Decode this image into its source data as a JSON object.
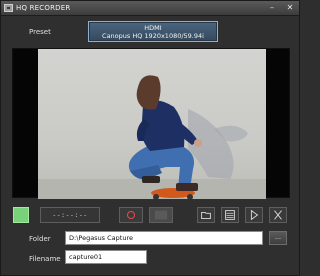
{
  "window": {
    "title": "HQ RECORDER",
    "minimize_glyph": "–",
    "close_glyph": "✕"
  },
  "preset": {
    "label": "Preset",
    "source": "HDMI",
    "format": "Canopus HQ 1920x1080/59.94i"
  },
  "preview": {
    "image": "skateboarder-crouching-photo"
  },
  "controls": {
    "status_color": "#78d27a",
    "timecode": "--:--:--",
    "record_icon": "record-icon",
    "stop_icon": "stop-icon",
    "open_folder_icon": "folder-icon",
    "clips_icon": "clip-list-icon",
    "play_icon": "play-icon",
    "exit_icon": "close-icon"
  },
  "folder": {
    "label": "Folder",
    "value": "D:\\Pegasus Capture",
    "browse_label": "..."
  },
  "filename": {
    "label": "Filename",
    "value": "capture01"
  },
  "colors": {
    "accent": "#4b6680",
    "background": "#2f2f2f"
  }
}
